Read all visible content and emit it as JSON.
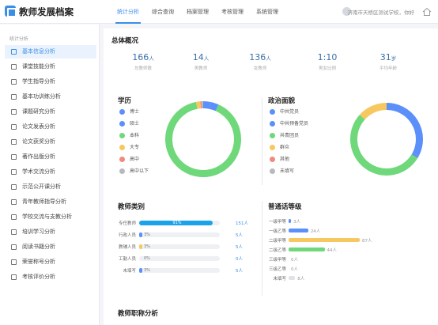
{
  "header": {
    "title": "教师发展档案",
    "nav": [
      "统计分析",
      "综合查询",
      "档案管理",
      "考核管理",
      "系统管理"
    ],
    "active_nav": 0,
    "user": "济南市天桥区测试学校，你好"
  },
  "sidebar": {
    "heading": "统计分析",
    "items": [
      {
        "label": "基本信息分析",
        "icon": "user-icon"
      },
      {
        "label": "课堂技能分析",
        "icon": "heart-icon"
      },
      {
        "label": "学生指导分析",
        "icon": "users-icon"
      },
      {
        "label": "基本功训练分析",
        "icon": "edit-icon"
      },
      {
        "label": "课题研究分析",
        "icon": "book-icon"
      },
      {
        "label": "论文发表分析",
        "icon": "file-icon"
      },
      {
        "label": "论文获奖分析",
        "icon": "file-icon"
      },
      {
        "label": "著作出版分析",
        "icon": "book-icon"
      },
      {
        "label": "学术交流分析",
        "icon": "chat-icon"
      },
      {
        "label": "示范公开课分析",
        "icon": "monitor-icon"
      },
      {
        "label": "青年教师指导分析",
        "icon": "user-icon"
      },
      {
        "label": "学校交流与支教分析",
        "icon": "flag-icon"
      },
      {
        "label": "培训学习分析",
        "icon": "list-icon"
      },
      {
        "label": "阅读书籍分析",
        "icon": "book-icon"
      },
      {
        "label": "荣誉称号分析",
        "icon": "award-icon"
      },
      {
        "label": "考核评价分析",
        "icon": "star-icon"
      }
    ]
  },
  "overview": {
    "title": "总体概况",
    "stats": [
      {
        "value": "166",
        "unit": "人",
        "label": "总教师数"
      },
      {
        "value": "14",
        "unit": "人",
        "label": "男教师"
      },
      {
        "value": "136",
        "unit": "人",
        "label": "女教师"
      },
      {
        "value": "1:10",
        "unit": "",
        "label": "男女比例"
      },
      {
        "value": "31",
        "unit": "岁",
        "label": "平均年龄"
      }
    ]
  },
  "education": {
    "title": "学历",
    "legend": [
      {
        "label": "博士",
        "color": "#5b8ff9"
      },
      {
        "label": "硕士",
        "color": "#5b8ff9"
      },
      {
        "label": "本科",
        "color": "#6fd87b"
      },
      {
        "label": "大专",
        "color": "#f6c85f"
      },
      {
        "label": "高中",
        "color": "#f08a7e"
      },
      {
        "label": "高中以下",
        "color": "#b6b9be"
      }
    ],
    "values": [
      5,
      6,
      150,
      3,
      1,
      1
    ]
  },
  "politics": {
    "title": "政治面貌",
    "legend": [
      {
        "label": "中共党员",
        "color": "#5b8ff9"
      },
      {
        "label": "中共预备党员",
        "color": "#5b8ff9"
      },
      {
        "label": "共青团员",
        "color": "#6fd87b"
      },
      {
        "label": "群众",
        "color": "#f6c85f"
      },
      {
        "label": "其他",
        "color": "#f08a7e"
      },
      {
        "label": "未填写",
        "color": "#b6b9be"
      }
    ],
    "values": [
      54,
      2,
      88,
      22,
      0,
      0
    ]
  },
  "teacher_type": {
    "title": "教师类别",
    "rows": [
      {
        "label": "专任教师",
        "pct": "91%",
        "pct_value": 0.91,
        "count": "151人",
        "color": "#1aa3e8"
      },
      {
        "label": "行政人员",
        "pct": "3%",
        "pct_value": 0.03,
        "count": "5人",
        "color": "#5b8ff9"
      },
      {
        "label": "教辅人员",
        "pct": "3%",
        "pct_value": 0.03,
        "count": "5人",
        "color": "#f6c85f"
      },
      {
        "label": "工勤人员",
        "pct": "0%",
        "pct_value": 0,
        "count": "0人",
        "color": "#5b8ff9"
      },
      {
        "label": "未填写",
        "pct": "3%",
        "pct_value": 0.03,
        "count": "5人",
        "color": "#5b8ff9"
      }
    ]
  },
  "mandarin": {
    "title": "普通话等级",
    "rows": [
      {
        "label": "一级甲等",
        "count": "3人",
        "value": 3,
        "color": "#5b8ff9"
      },
      {
        "label": "一级乙等",
        "count": "24人",
        "value": 24,
        "color": "#5b8ff9"
      },
      {
        "label": "二级甲等",
        "count": "87人",
        "value": 87,
        "color": "#f6c85f"
      },
      {
        "label": "二级乙等",
        "count": "44人",
        "value": 44,
        "color": "#6fd87b"
      },
      {
        "label": "三级甲等",
        "count": "0人",
        "value": 0,
        "color": "#5b8ff9"
      },
      {
        "label": "三级乙等",
        "count": "0人",
        "value": 0,
        "color": "#5b8ff9"
      },
      {
        "label": "未填写",
        "count": "8人",
        "value": 8,
        "color": "#dfe3e8"
      }
    ]
  },
  "title_analysis": {
    "title": "教师职称分析"
  }
}
